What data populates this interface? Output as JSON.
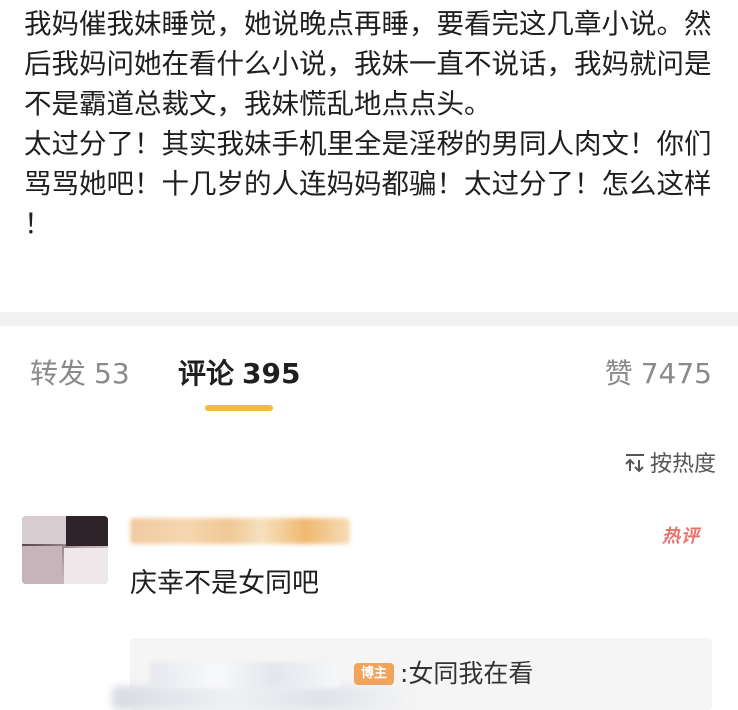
{
  "post": {
    "paragraphs": [
      "我妈催我妹睡觉，她说晚点再睡，要看完这几章小说。然后我妈问她在看什么小说，我妹一直不说话，我妈就问是不是霸道总裁文，我妹慌乱地点点头。",
      "太过分了！其实我妹手机里全是淫秽的男同人肉文！你们骂骂她吧！十几岁的人连妈妈都骗！太过分了！怎么这样！"
    ]
  },
  "tabs": {
    "repost": {
      "label": "转发",
      "count": "53"
    },
    "comments": {
      "label": "评论",
      "count": "395"
    },
    "likes": {
      "label": "赞",
      "count": "7475"
    },
    "active": "comments"
  },
  "sort": {
    "label": "按热度",
    "icon": "sort-icon"
  },
  "comment": {
    "badge": "热评",
    "text": "庆幸不是女同吧",
    "reply": {
      "author_badge": "博主",
      "text": ":女同我在看"
    }
  },
  "colors": {
    "accent_indicator": "#f4b942",
    "hot_badge": "#e8736d",
    "author_badge": "#f0a35a",
    "divider": "#f1f1f1"
  }
}
